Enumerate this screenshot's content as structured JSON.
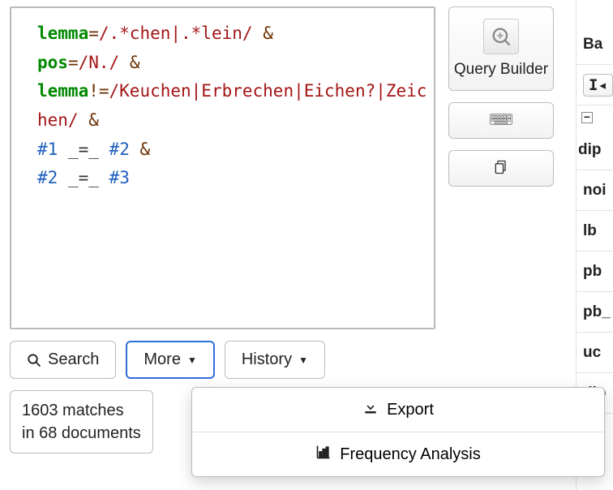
{
  "query": {
    "raw": "lemma=/.*chen|.*lein/ &\npos=/N./ &\nlemma!=/Keuchen|Erbrechen|Eichen?|Zeichen/ &\n#1 _=_ #2 &\n#2 _=_ #3",
    "tokens": [
      [
        {
          "t": "lemma",
          "c": "kw-attr"
        },
        {
          "t": "=",
          "c": "kw-op"
        },
        {
          "t": "/.*chen|.*lein/",
          "c": "kw-regex"
        },
        {
          "t": " ",
          "c": ""
        },
        {
          "t": "&",
          "c": "kw-amp"
        }
      ],
      [
        {
          "t": "pos",
          "c": "kw-attr"
        },
        {
          "t": "=",
          "c": "kw-op"
        },
        {
          "t": "/N./",
          "c": "kw-regex"
        },
        {
          "t": " ",
          "c": ""
        },
        {
          "t": "&",
          "c": "kw-amp"
        }
      ],
      [
        {
          "t": "lemma",
          "c": "kw-attr"
        },
        {
          "t": "!=",
          "c": "kw-op"
        },
        {
          "t": "/Keuchen|Erbrechen|Eichen?|Zeichen/",
          "c": "kw-regex"
        },
        {
          "t": " ",
          "c": ""
        },
        {
          "t": "&",
          "c": "kw-amp"
        }
      ],
      [
        {
          "t": "#1",
          "c": "kw-ref"
        },
        {
          "t": " ",
          "c": ""
        },
        {
          "t": "_=_",
          "c": "kw-us"
        },
        {
          "t": " ",
          "c": ""
        },
        {
          "t": "#2",
          "c": "kw-ref"
        },
        {
          "t": " ",
          "c": ""
        },
        {
          "t": "&",
          "c": "kw-amp"
        }
      ],
      [
        {
          "t": "#2",
          "c": "kw-ref"
        },
        {
          "t": " ",
          "c": ""
        },
        {
          "t": "_=_",
          "c": "kw-us"
        },
        {
          "t": " ",
          "c": ""
        },
        {
          "t": "#3",
          "c": "kw-ref"
        }
      ]
    ]
  },
  "buttons": {
    "search": "Search",
    "more": "More",
    "history": "History",
    "query_builder": "Query Builder"
  },
  "more_menu": {
    "export": "Export",
    "frequency": "Frequency Analysis"
  },
  "results": {
    "matches": 1603,
    "documents": 68,
    "matches_line": "1603 matches",
    "documents_line": "in 68 documents"
  },
  "right_strip": {
    "items": [
      "Ba",
      "I",
      "dip",
      "noi",
      "lb",
      "pb",
      "pb_",
      "uc",
      "dip"
    ]
  },
  "icons": {
    "search": "search-icon",
    "caret": "caret-down-icon",
    "wrench": "wrench-icon",
    "keyboard": "keyboard-icon",
    "copy": "copy-icon",
    "help": "help-icon",
    "download": "download-icon",
    "barchart": "barchart-icon",
    "collapse": "collapse-icon"
  },
  "colors": {
    "selected_border": "#2f6fd8",
    "attr": "#008800",
    "regex": "#a31515",
    "operator": "#6a2e00",
    "reference": "#1f5fbf"
  }
}
